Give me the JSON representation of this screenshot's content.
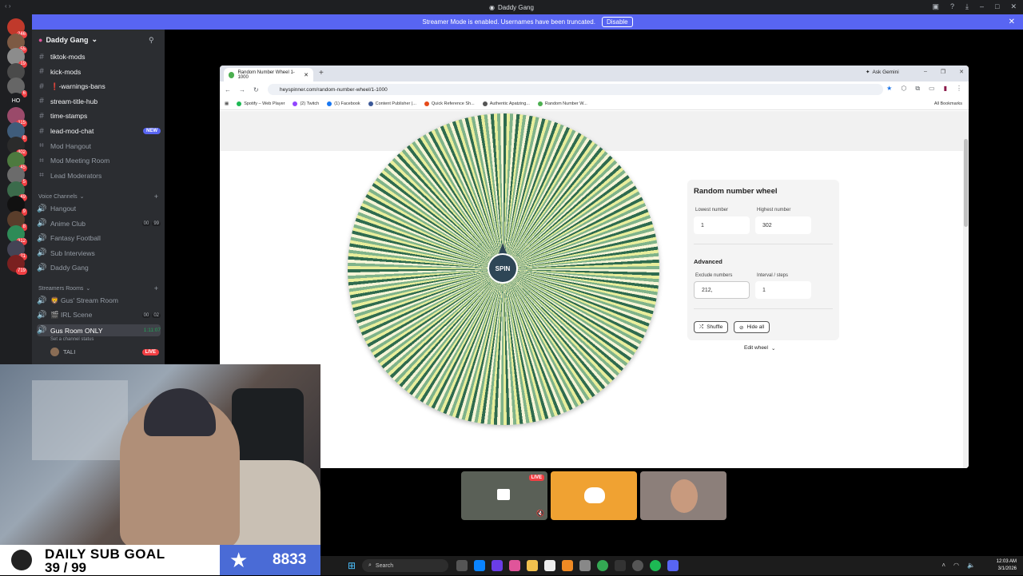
{
  "window": {
    "title": "Daddy Gang"
  },
  "banner": {
    "text": "Streamer Mode is enabled. Usernames have been truncated.",
    "button": "Disable"
  },
  "servers": [
    {
      "label": "",
      "badge": "246"
    },
    {
      "label": "",
      "badge": "55"
    },
    {
      "label": "",
      "badge": "19"
    },
    {
      "label": "",
      "badge": ""
    },
    {
      "label": "",
      "badge": "6"
    },
    {
      "label": "HO",
      "badge": ""
    },
    {
      "label": "",
      "badge": "115"
    },
    {
      "label": "",
      "badge": "8"
    },
    {
      "label": "",
      "badge": "402"
    },
    {
      "label": "",
      "badge": "45"
    },
    {
      "label": "",
      "badge": "5"
    },
    {
      "label": "",
      "badge": "49"
    },
    {
      "label": "",
      "badge": "9"
    },
    {
      "label": "",
      "badge": "8"
    },
    {
      "label": "",
      "badge": "312"
    },
    {
      "label": "",
      "badge": "21"
    },
    {
      "label": "",
      "badge": "719"
    }
  ],
  "guild": {
    "name": "Daddy Gang"
  },
  "text_channels": [
    {
      "name": "tiktok-mods",
      "bright": true,
      "new": ""
    },
    {
      "name": "kick-mods",
      "bright": true,
      "new": ""
    },
    {
      "name": "❗-warnings-bans",
      "bright": true,
      "new": ""
    },
    {
      "name": "stream-title-hub",
      "bright": true,
      "new": ""
    },
    {
      "name": "time-stamps",
      "bright": true,
      "new": ""
    },
    {
      "name": "lead-mod-chat",
      "bright": true,
      "new": "NEW"
    },
    {
      "name": "Mod Hangout",
      "bright": false,
      "new": ""
    },
    {
      "name": "Mod Meeting Room",
      "bright": false,
      "new": ""
    },
    {
      "name": "Lead Moderators",
      "bright": false,
      "new": ""
    }
  ],
  "voice_category": "Voice Channels",
  "voice_channels": [
    {
      "name": "Hangout",
      "c1": "",
      "c2": ""
    },
    {
      "name": "Anime Club",
      "c1": "00",
      "c2": "99"
    },
    {
      "name": "Fantasy Football",
      "c1": "",
      "c2": ""
    },
    {
      "name": "Sub Interviews",
      "c1": "",
      "c2": ""
    },
    {
      "name": "Daddy Gang",
      "c1": "",
      "c2": ""
    }
  ],
  "streamers_category": "Streamers Rooms",
  "streamer_channels": [
    {
      "name": "🦁 Gus' Stream Room",
      "c1": "",
      "c2": ""
    },
    {
      "name": "🎬 IRL Scene",
      "c1": "00",
      "c2": "02"
    }
  ],
  "active_channel": {
    "name": "Gus Room ONLY",
    "timer": "1:11:07",
    "status": "Set a channel status"
  },
  "voice_user": {
    "name": "TALI",
    "badge": "LIVE"
  },
  "browser": {
    "tab_title": "Random Number Wheel 1-1000",
    "ask_gemini": "Ask Gemini",
    "url": "heyspinner.com/random-number-wheel/1-1000",
    "bookmarks": [
      "Spotify – Web Player",
      "(2) Twitch",
      "(1) Facebook",
      "Content Publisher |...",
      "Quick Reference Sh...",
      "Authentic Apatzing...",
      "Random Number W..."
    ],
    "all_bookmarks": "All Bookmarks"
  },
  "wheel": {
    "spin_label": "SPIN",
    "panel_title": "Random number wheel",
    "lowest_label": "Lowest number",
    "lowest_value": "1",
    "highest_label": "Highest number",
    "highest_value": "302",
    "advanced_label": "Advanced",
    "exclude_label": "Exclude numbers",
    "exclude_value": "212,",
    "interval_label": "Interval / steps",
    "interval_value": "1",
    "shuffle_label": "Shuffle",
    "hide_label": "Hide all",
    "edit_label": "Edit wheel"
  },
  "call_tiles": {
    "live_badge": "LIVE"
  },
  "sub_goal": {
    "line1": "DAILY SUB GOAL",
    "line2": "39 / 99",
    "number": "8833"
  },
  "taskbar": {
    "search": "Search",
    "time": "12:03 AM",
    "date": "3/1/2026"
  }
}
